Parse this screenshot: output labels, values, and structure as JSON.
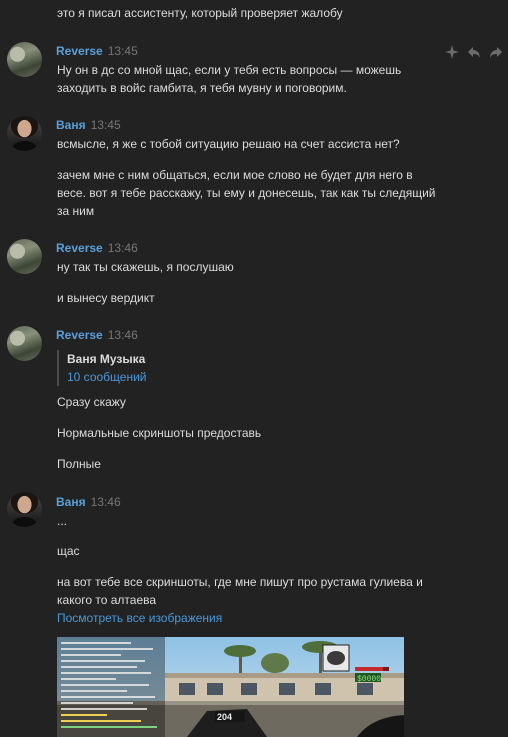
{
  "prev_message": {
    "text": "это я писал ассистенту, который проверяет жалобу"
  },
  "toolbar": {
    "icons": [
      "sparkle-icon",
      "reply-icon",
      "forward-icon"
    ]
  },
  "messages": [
    {
      "author": "Reverse",
      "time": "13:45",
      "lines": [
        "Ну он в дс со мной щас, если у тебя есть вопросы — можешь",
        "заходить в войс гамбита, я тебя мувну и поговорим."
      ]
    },
    {
      "author": "Ваня",
      "time": "13:45",
      "lines": [
        "всмысле, я же с тобой ситуацию решаю на счет ассиста нет?",
        "зачем мне с ним общаться, если мое слово не будет для него в",
        "весе. вот я тебе расскажу, ты ему и донесешь, так как ты следящий",
        "за ним"
      ]
    },
    {
      "author": "Reverse",
      "time": "13:46",
      "lines": [
        "ну так ты скажешь, я послушаю",
        "и вынесу вердикт"
      ]
    },
    {
      "author": "Reverse",
      "time": "13:46",
      "quote": {
        "name": "Ваня Музыка",
        "count": "10 сообщений"
      },
      "lines": [
        "Сразу скажу",
        "Нормальные скриншоты предоставь",
        "Полные"
      ]
    },
    {
      "author": "Ваня",
      "time": "13:46",
      "lines": [
        "...",
        "щас",
        "на вот тебе все скриншоты, где мне пишут про рустама гулиева и",
        "какого то алтаева"
      ],
      "link": "Посмотреть все изображения"
    }
  ],
  "game_hud": {
    "ammo": "204"
  }
}
